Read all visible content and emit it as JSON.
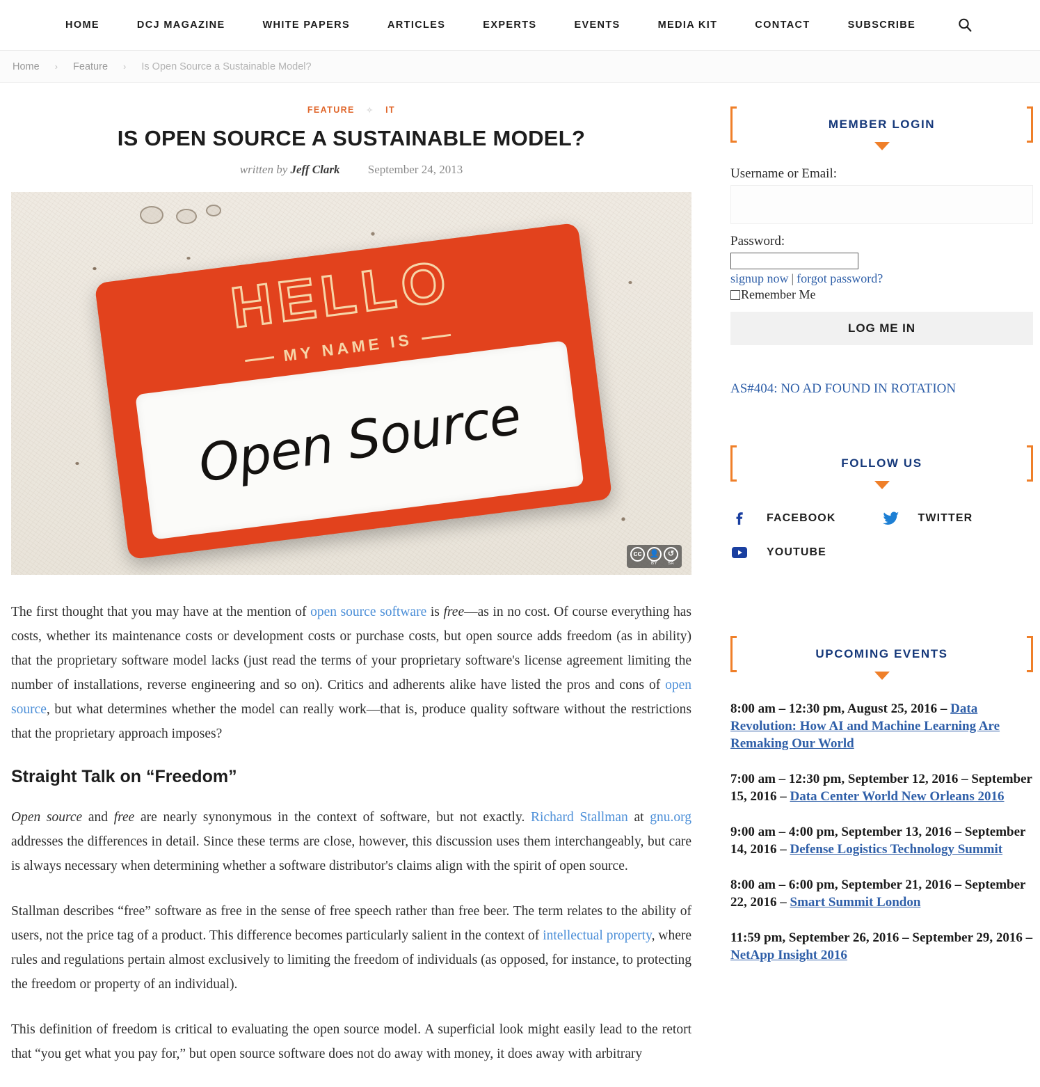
{
  "nav": {
    "items": [
      {
        "label": "HOME",
        "name": "nav-home"
      },
      {
        "label": "DCJ MAGAZINE",
        "name": "nav-dcj-magazine"
      },
      {
        "label": "WHITE PAPERS",
        "name": "nav-white-papers"
      },
      {
        "label": "ARTICLES",
        "name": "nav-articles"
      },
      {
        "label": "EXPERTS",
        "name": "nav-experts"
      },
      {
        "label": "EVENTS",
        "name": "nav-events"
      },
      {
        "label": "MEDIA KIT",
        "name": "nav-media-kit"
      },
      {
        "label": "CONTACT",
        "name": "nav-contact"
      },
      {
        "label": "SUBSCRIBE",
        "name": "nav-subscribe"
      }
    ],
    "search_icon": "search-icon"
  },
  "breadcrumb": {
    "home": "Home",
    "sep1": "›",
    "section": "Feature",
    "sep2": "›",
    "current": "Is Open Source a Sustainable Model?"
  },
  "article": {
    "category_primary": "FEATURE",
    "category_diamond": "✧",
    "category_secondary": "IT",
    "title": "IS OPEN SOURCE A SUSTAINABLE MODEL?",
    "written_by_label": "written by",
    "author": "Jeff Clark",
    "date": "September 24, 2013",
    "hero": {
      "sticker_hello": "HELLO",
      "sticker_myname": "MY NAME IS",
      "sticker_value": "Open Source",
      "license_badge": "CC BY-SA",
      "cc_mark": "cc",
      "cc_by": "BY",
      "cc_sa": "SA"
    },
    "paragraphs": {
      "p1_a": "The first thought that you may have at the mention of ",
      "p1_link1": "open source software",
      "p1_b": " is ",
      "p1_em1": "free",
      "p1_c": "—as in no cost. Of course everything has costs, whether its maintenance costs or development costs or purchase costs, but open source adds freedom (as in ability) that the proprietary software model lacks (just read the terms of your proprietary software's license agreement limiting the number of installations, reverse engineering and so on). Critics and adherents alike have listed the pros and cons of ",
      "p1_link2": "open source",
      "p1_d": ", but what determines whether the model can really work—that is, produce quality software without the restrictions that the proprietary approach imposes?",
      "h2": "Straight Talk on “Freedom”",
      "p2_em1": "Open source",
      "p2_a": " and ",
      "p2_em2": "free",
      "p2_b": " are nearly synonymous in the context of software, but not exactly. ",
      "p2_link1": "Richard Stallman",
      "p2_c": " at ",
      "p2_link2": "gnu.org",
      "p2_d": " addresses the differences in detail. Since these terms are close, however, this discussion uses them interchangeably, but care is always necessary when determining whether a software distributor's claims align with the spirit of open source.",
      "p3_a": "Stallman describes “free” software as free in the sense of free speech rather than free beer. The term relates to the ability of users, not the price tag of a product. This difference becomes particularly salient in the context of ",
      "p3_link1": "intellectual property",
      "p3_b": ", where rules and regulations pertain almost exclusively to limiting the freedom of individuals (as opposed, for instance, to protecting the freedom or property of an individual).",
      "p4": "This definition of freedom is critical to evaluating the open source model. A superficial look might easily lead to the retort that “you get what you pay for,” but open source software does not do away with money, it does away with arbitrary"
    }
  },
  "sidebar": {
    "login": {
      "heading": "MEMBER LOGIN",
      "username_label": "Username or Email:",
      "username_value": "",
      "username_placeholder": "",
      "password_label": "Password:",
      "password_value": "",
      "signup_label": "signup now",
      "link_divider": "|",
      "forgot_label": "forgot password?",
      "remember_label": "Remember Me",
      "submit_label": "LOG ME IN"
    },
    "ad": {
      "text": "AS#404: NO AD FOUND IN ROTATION"
    },
    "follow": {
      "heading": "FOLLOW US",
      "items": [
        {
          "label": "FACEBOOK",
          "icon": "facebook-icon"
        },
        {
          "label": "TWITTER",
          "icon": "twitter-icon"
        },
        {
          "label": "YOUTUBE",
          "icon": "youtube-icon"
        }
      ]
    },
    "events": {
      "heading": "UPCOMING EVENTS",
      "items": [
        {
          "when": "8:00 am – 12:30 pm, August 25, 2016 – ",
          "link": "Data Revolution: How AI and Machine Learning Are Remaking Our World"
        },
        {
          "when": "7:00 am – 12:30 pm, September 12, 2016 – September 15, 2016 – ",
          "link": "Data Center World New Orleans 2016"
        },
        {
          "when": "9:00 am – 4:00 pm, September 13, 2016 – September 14, 2016 – ",
          "link": "Defense Logistics Technology Summit"
        },
        {
          "when": "8:00 am – 6:00 pm, September 21, 2016 – September 22, 2016 – ",
          "link": "Smart Summit London"
        },
        {
          "when": "11:59 pm, September 26, 2016 – September 29, 2016 – ",
          "link": "NetApp Insight 2016"
        }
      ]
    }
  },
  "colors": {
    "accent_orange": "#ef7f29",
    "heading_blue": "#15387a",
    "link_blue": "#2f5fa8",
    "body_link_blue": "#4c8fd8",
    "category_orange": "#e0672c",
    "sticker_red": "#e2421d"
  }
}
